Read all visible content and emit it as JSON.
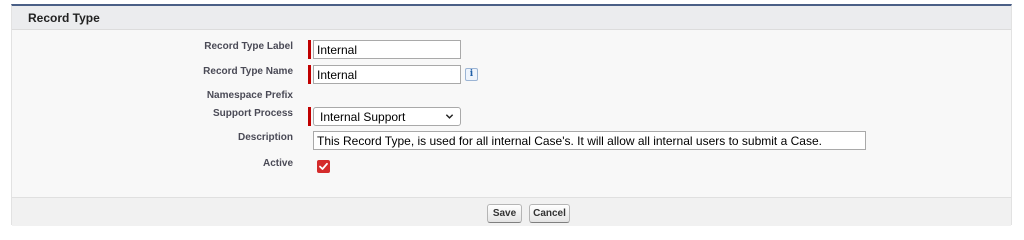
{
  "section": {
    "title": "Record Type"
  },
  "fields": {
    "record_type_label": {
      "label": "Record Type Label",
      "value": "Internal",
      "required": true
    },
    "record_type_name": {
      "label": "Record Type Name",
      "value": "Internal",
      "required": true,
      "help_icon": "info-icon",
      "help_glyph": "i"
    },
    "namespace_prefix": {
      "label": "Namespace Prefix",
      "value": ""
    },
    "support_process": {
      "label": "Support Process",
      "selected": "Internal Support",
      "required": true
    },
    "description": {
      "label": "Description",
      "value": "This Record Type, is used for all internal Case's. It will allow all internal users to submit a Case."
    },
    "active": {
      "label": "Active",
      "checked": true
    }
  },
  "buttons": {
    "save": "Save",
    "cancel": "Cancel"
  },
  "colors": {
    "required_marker": "#c00000",
    "checkbox_checked": "#d42b2b",
    "header_border": "#4a5f86"
  }
}
